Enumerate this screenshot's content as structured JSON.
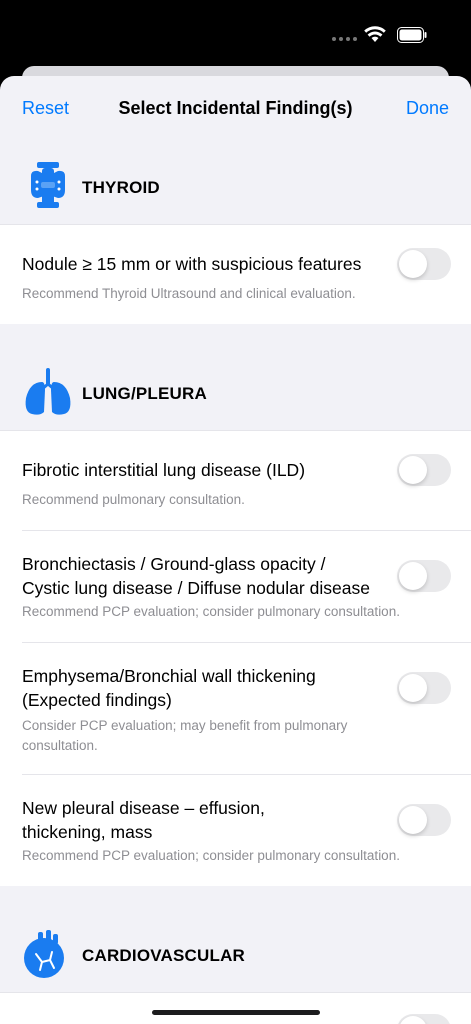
{
  "nav": {
    "reset_label": "Reset",
    "title": "Select Incidental Finding(s)",
    "done_label": "Done"
  },
  "colors": {
    "accent": "#007aff",
    "icon_blue": "#1a7cf0",
    "toggle_off": "#e9e9eb"
  },
  "sections": [
    {
      "title": "THYROID",
      "icon": "thyroid-icon",
      "items": [
        {
          "title": "Nodule ≥ 15 mm or with suspicious features",
          "subtitle": "Recommend Thyroid Ultrasound and clinical evaluation.",
          "enabled": false
        }
      ]
    },
    {
      "title": "LUNG/PLEURA",
      "icon": "lungs-icon",
      "items": [
        {
          "title": "Fibrotic interstitial lung disease (ILD)",
          "subtitle": "Recommend pulmonary consultation.",
          "enabled": false
        },
        {
          "title_line1": "Bronchiectasis / Ground-glass opacity /",
          "title_line2": "Cystic lung disease / Diffuse nodular disease",
          "subtitle": "Recommend PCP evaluation; consider pulmonary consultation.",
          "enabled": false
        },
        {
          "title_line1": "Emphysema/Bronchial wall thickening",
          "title_line2": "(Expected findings)",
          "subtitle_line1": "Consider PCP evaluation; may benefit from pulmonary",
          "subtitle_line2": "consultation.",
          "enabled": false
        },
        {
          "title_line1": "New pleural disease – effusion,",
          "title_line2": "thickening, mass",
          "subtitle": "Recommend PCP evaluation; consider pulmonary consultation.",
          "enabled": false
        }
      ]
    },
    {
      "title": "CARDIOVASCULAR",
      "icon": "heart-icon",
      "items": []
    }
  ]
}
